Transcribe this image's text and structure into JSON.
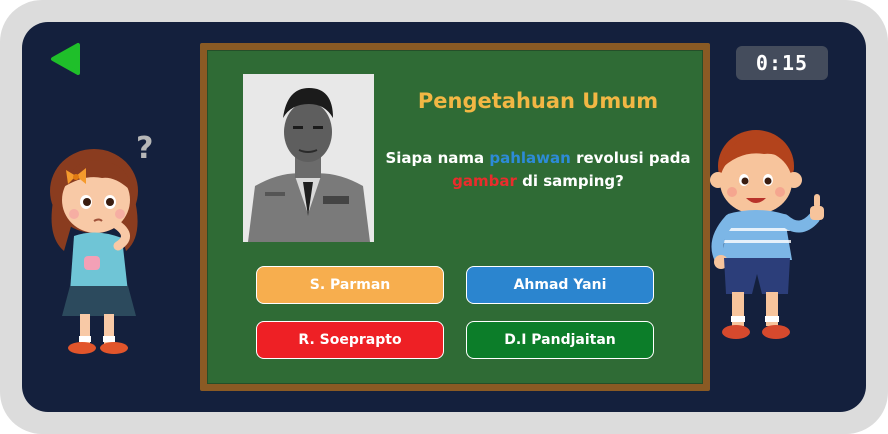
{
  "timer": {
    "value": "0:15"
  },
  "board": {
    "title": "Pengetahuan Umum",
    "question": {
      "part1": "Siapa nama ",
      "highlight1": "pahlawan",
      "part2": " revolusi pada ",
      "highlight2": "gambar",
      "part3": " di samping?"
    }
  },
  "answers": [
    {
      "label": "S. Parman",
      "color": "#f7ae4e"
    },
    {
      "label": "Ahmad Yani",
      "color": "#2b85cf"
    },
    {
      "label": "R. Soeprapto",
      "color": "#ee2025"
    },
    {
      "label": "D.I Pandjaitan",
      "color": "#0c7d29"
    }
  ],
  "colors": {
    "background": "#14203d",
    "board_green": "#2f6b35",
    "board_frame": "#8a5a24",
    "title": "#f2b744",
    "highlight_blue": "#2d8bd7",
    "highlight_red": "#ea2c2c",
    "back_arrow": "#1fbf2a"
  },
  "icons": {
    "back": "back-arrow-icon",
    "question_mark": "question-mark-icon"
  }
}
